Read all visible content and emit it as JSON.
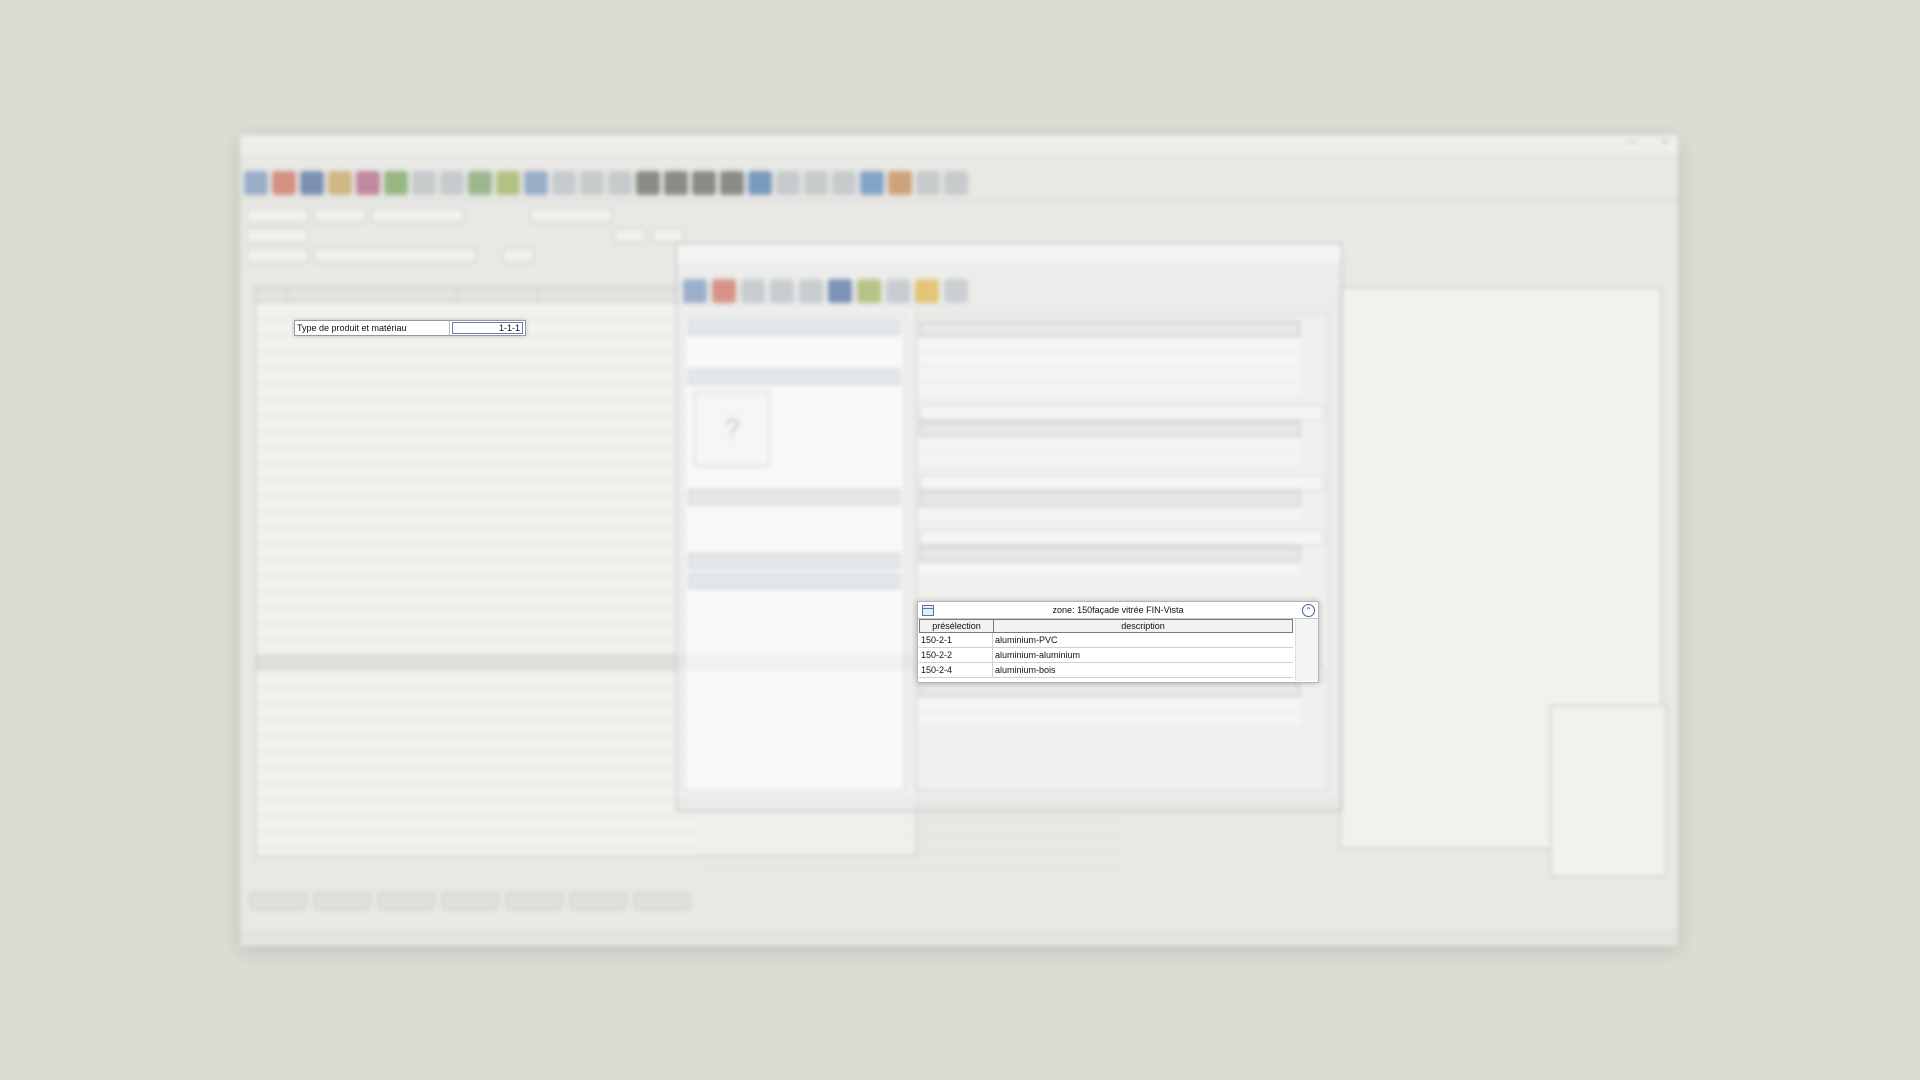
{
  "focus_field": {
    "label": "Type de produit et matériau",
    "value": "1-1-1"
  },
  "zone_panel": {
    "title": "zone: 150façade vitrée FIN-Vista",
    "columns": {
      "preselection": "présélection",
      "description": "description"
    },
    "rows": [
      {
        "code": "150-2-1",
        "description": "aluminium-PVC"
      },
      {
        "code": "150-2-2",
        "description": "aluminium-aluminium"
      },
      {
        "code": "150-2-4",
        "description": "aluminium-bois"
      }
    ]
  },
  "icons": {
    "zone_icon": "table-icon",
    "collapse": "collapse-up-icon"
  }
}
